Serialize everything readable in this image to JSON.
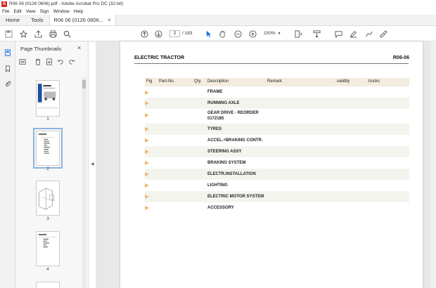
{
  "window": {
    "title": "R06 06 (0126 0606).pdf - Adobe Acrobat Pro DC (32-bit)"
  },
  "menu": [
    "File",
    "Edit",
    "View",
    "Sign",
    "Window",
    "Help"
  ],
  "tabs": {
    "home": "Home",
    "tools": "Tools",
    "doc": "R06 06 (0126 0606...",
    "close": "×"
  },
  "toolbar": {
    "page_current": "2",
    "page_total": "/ 183",
    "zoom": "100%"
  },
  "thumbs_panel": {
    "title": "Page Thumbnails",
    "close": "×",
    "pages": [
      "1",
      "2",
      "3",
      "4"
    ]
  },
  "document": {
    "title": "ELECTRIC TRACTOR",
    "code": "R06-06",
    "columns": [
      "Fig",
      "Part-No.",
      "Qty.",
      "Description",
      "Remark",
      "validity",
      "trucks"
    ],
    "rows": [
      {
        "desc": "FRAME"
      },
      {
        "desc": "RUNNING AXLE"
      },
      {
        "desc": "GEAR DRIVE - REORDER",
        "desc2": "0172185"
      },
      {
        "desc": "TYRES"
      },
      {
        "desc": "ACCEL.+BRAKING CONTR."
      },
      {
        "desc": "STEERING ASSY"
      },
      {
        "desc": "BRAKING SYSTEM"
      },
      {
        "desc": "ELECTR.INSTALLATION"
      },
      {
        "desc": "LIGHTING"
      },
      {
        "desc": "ELECTRIC MOTOR SYSTEM"
      },
      {
        "desc": "ACCESSORY"
      }
    ]
  },
  "colors": {
    "accent": "#1473e6",
    "header_band": "#f4ecdf",
    "arrow": "#e8b97a"
  }
}
